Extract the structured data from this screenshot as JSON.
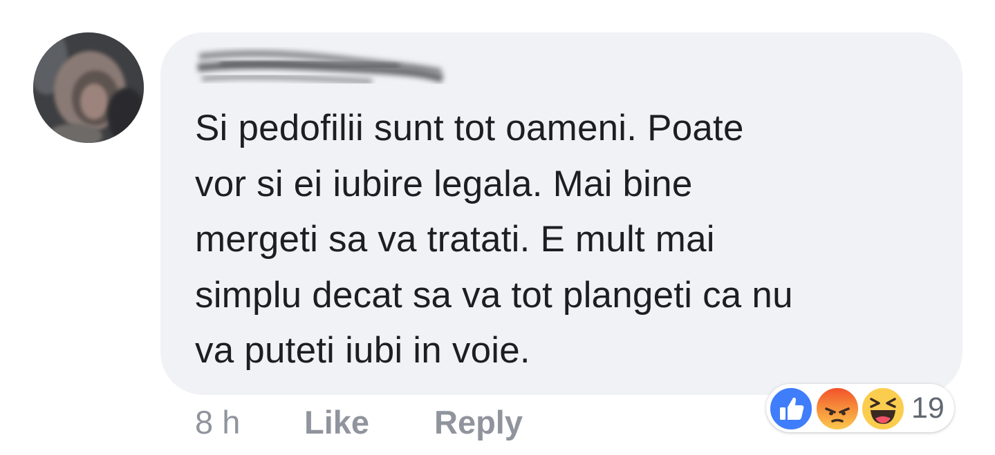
{
  "comment": {
    "author_name": "",
    "text_lines": [
      "Si pedofilii sunt tot oameni. Poate",
      "vor si ei iubire legala. Mai bine",
      "mergeti sa va tratati. E mult mai",
      "simplu decat sa va tot plangeti ca nu",
      "va puteti iubi in voie."
    ],
    "timestamp": "8 h",
    "like_label": "Like",
    "reply_label": "Reply"
  },
  "reactions": {
    "types": [
      "like-icon",
      "angry-icon",
      "haha-icon"
    ],
    "count": "19"
  },
  "colors": {
    "bubble_bg": "#f1f2f5",
    "text": "#1c1e21",
    "meta": "#90949c",
    "like_blue": "#3f7dfa",
    "haha_yellow": "#fbcd4f",
    "angry_red": "#f2522b"
  }
}
